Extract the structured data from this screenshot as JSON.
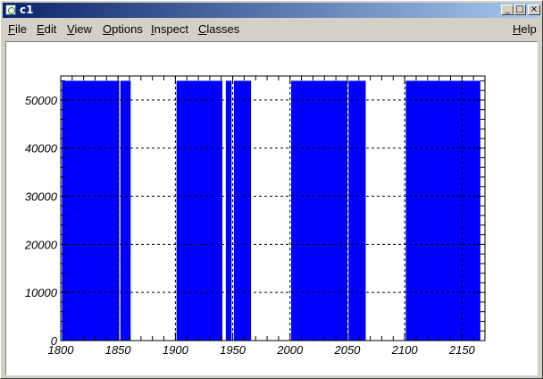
{
  "window": {
    "title": "c1"
  },
  "titlebar_buttons": {
    "minimize": "_",
    "maximize": "□",
    "close": "×"
  },
  "menubar": {
    "items": [
      {
        "label": "File",
        "underline": "F",
        "rest": "ile"
      },
      {
        "label": "Edit",
        "underline": "E",
        "rest": "dit"
      },
      {
        "label": "View",
        "underline": "V",
        "rest": "iew"
      },
      {
        "label": "Options",
        "underline": "O",
        "rest": "ptions"
      },
      {
        "label": "Inspect",
        "underline": "I",
        "rest": "nspect"
      },
      {
        "label": "Classes",
        "underline": "C",
        "rest": "lasses"
      }
    ],
    "help": {
      "label": "Help",
      "underline": "H",
      "rest": "elp"
    }
  },
  "chart_data": {
    "type": "bar",
    "xlim": [
      1800,
      2170
    ],
    "ylim": [
      0,
      55000
    ],
    "x_ticks": [
      "1800",
      "1850",
      "1900",
      "1950",
      "2000",
      "2050",
      "2100",
      "2150"
    ],
    "y_ticks": [
      "0",
      "10000",
      "20000",
      "30000",
      "40000",
      "50000"
    ],
    "grid": true,
    "bar_color": "#0000ff",
    "bars": [
      {
        "x0": 1801,
        "x1": 1851,
        "value": 54000
      },
      {
        "x0": 1852,
        "x1": 1861,
        "value": 54000
      },
      {
        "x0": 1901,
        "x1": 1941,
        "value": 54000
      },
      {
        "x0": 1944,
        "x1": 1949,
        "value": 54000
      },
      {
        "x0": 1951,
        "x1": 1966,
        "value": 54000
      },
      {
        "x0": 2001,
        "x1": 2050,
        "value": 54000
      },
      {
        "x0": 2051,
        "x1": 2066,
        "value": 54000
      },
      {
        "x0": 2101,
        "x1": 2166,
        "value": 54000
      }
    ]
  }
}
